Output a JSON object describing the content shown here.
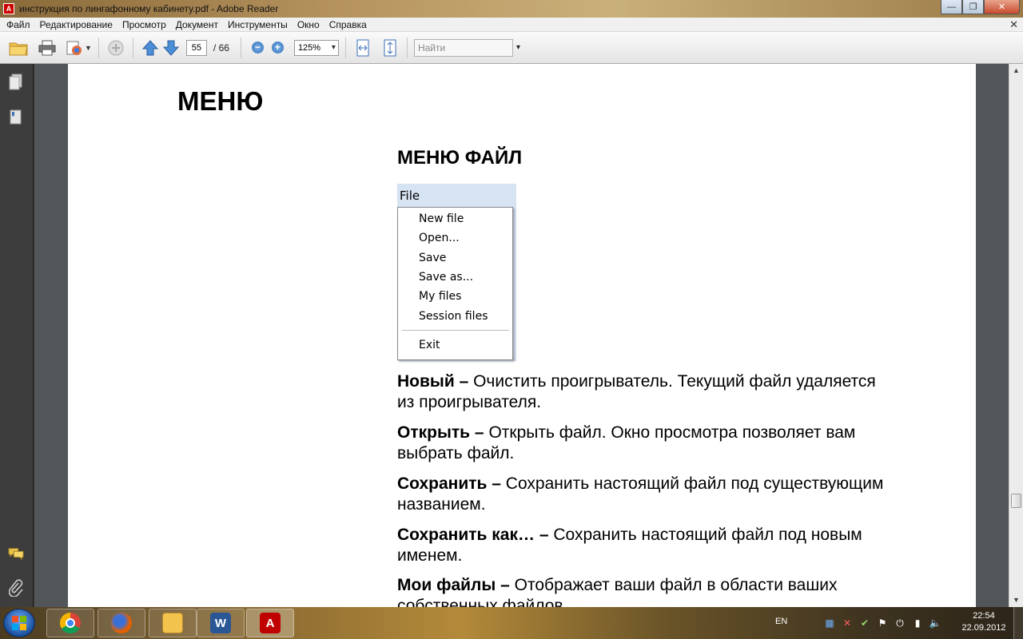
{
  "window": {
    "title": "инструкция по лингафонному кабинету.pdf - Adobe Reader",
    "min_glyph": "—",
    "max_glyph": "❐",
    "close_glyph": "✕"
  },
  "menubar": {
    "items": [
      "Файл",
      "Редактирование",
      "Просмотр",
      "Документ",
      "Инструменты",
      "Окно",
      "Справка"
    ],
    "close_glyph": "✕"
  },
  "toolbar": {
    "page_current": "55",
    "page_total": "/ 66",
    "zoom_out": "−",
    "zoom_in": "+",
    "zoom_value": "125%",
    "search_placeholder": "Найти",
    "search_dropdown": "▾"
  },
  "document": {
    "heading": "МЕНЮ",
    "subheading": "МЕНЮ ФАЙЛ",
    "file_menu": {
      "title": "File",
      "items": [
        "New file",
        "Open...",
        "Save",
        "Save as...",
        "My files",
        "Session files"
      ],
      "exit": "Exit"
    },
    "paragraphs": [
      {
        "term": "Новый –",
        "text": " Очистить проигрыватель. Текущий файл удаляется из проигрывателя."
      },
      {
        "term": "Открыть –",
        "text": " Открыть файл. Окно просмотра позволяет вам выбрать файл."
      },
      {
        "term": "Сохранить –",
        "text": " Сохранить настоящий файл под существующим названием."
      },
      {
        "term": "Сохранить как… –",
        "text": " Сохранить настоящий файл под новым именем."
      },
      {
        "term": "Мои файлы –",
        "text": " Отображает ваши файл в области ваших собственных файлов."
      }
    ]
  },
  "taskbar": {
    "language": "EN",
    "time": "22:54",
    "date": "22.09.2012",
    "apps": [
      "chrome-icon",
      "firefox-icon",
      "explorer-icon",
      "word-icon",
      "acrobat-icon"
    ]
  },
  "colors": {
    "acrobat_red": "#c00000",
    "word_blue": "#2b5797",
    "menu_highlight": "#d6e3f2"
  }
}
